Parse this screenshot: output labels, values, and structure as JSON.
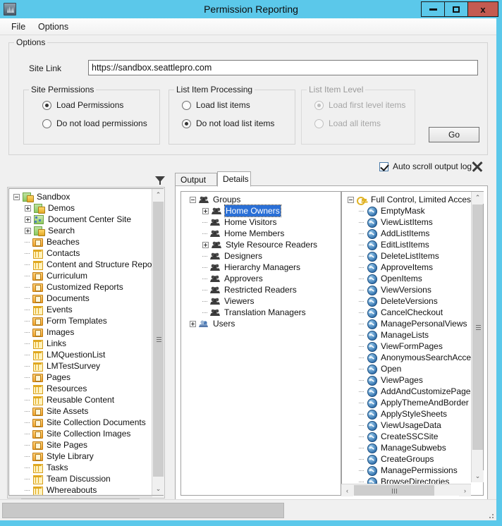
{
  "window": {
    "title": "Permission Reporting",
    "app_icon": "app-icon",
    "minimize_label": "",
    "maximize_label": "",
    "close_label": "x",
    "frame_color": "#5bc8ea"
  },
  "menu": {
    "items": [
      {
        "label": "File"
      },
      {
        "label": "Options"
      }
    ]
  },
  "options": {
    "legend": "Options",
    "site_link_label": "Site Link",
    "site_link_value": "https://sandbox.seattlepro.com",
    "site_link_placeholder": "",
    "site_permissions": {
      "legend": "Site Permissions",
      "options": [
        {
          "label": "Load Permissions",
          "checked": true
        },
        {
          "label": "Do not load permissions",
          "checked": false
        }
      ]
    },
    "list_item_processing": {
      "legend": "List Item Processing",
      "options": [
        {
          "label": "Load list items",
          "checked": false
        },
        {
          "label": "Do not load list items",
          "checked": true
        }
      ]
    },
    "list_item_level": {
      "legend": "List Item Level",
      "disabled": true,
      "options": [
        {
          "label": "Load first level items",
          "checked": true
        },
        {
          "label": "Load all items",
          "checked": false
        }
      ]
    },
    "go_button": "Go"
  },
  "toolbar": {
    "filter_icon": "funnel-icon",
    "auto_scroll_label": "Auto scroll output log",
    "auto_scroll_checked": true,
    "close_icon": "close-x-icon"
  },
  "tabs": [
    {
      "label": "Output Log",
      "active": false
    },
    {
      "label": "Details",
      "active": true
    }
  ],
  "site_tree": {
    "nodes": [
      {
        "label": "Sandbox",
        "indent": 0,
        "expander": "minus",
        "icon": "site-lock-icon"
      },
      {
        "label": "Demos",
        "indent": 1,
        "expander": "plus",
        "icon": "site-lock-icon"
      },
      {
        "label": "Document Center Site",
        "indent": 1,
        "expander": "plus",
        "icon": "site-icon"
      },
      {
        "label": "Search",
        "indent": 1,
        "expander": "plus",
        "icon": "site-lock-icon"
      },
      {
        "label": "Beaches",
        "indent": 1,
        "expander": "none",
        "icon": "library-icon"
      },
      {
        "label": "Contacts",
        "indent": 1,
        "expander": "none",
        "icon": "list-icon"
      },
      {
        "label": "Content and Structure Reports",
        "indent": 1,
        "expander": "none",
        "icon": "list-icon"
      },
      {
        "label": "Curriculum",
        "indent": 1,
        "expander": "none",
        "icon": "library-icon"
      },
      {
        "label": "Customized Reports",
        "indent": 1,
        "expander": "none",
        "icon": "library-icon"
      },
      {
        "label": "Documents",
        "indent": 1,
        "expander": "none",
        "icon": "library-icon"
      },
      {
        "label": "Events",
        "indent": 1,
        "expander": "none",
        "icon": "list-icon"
      },
      {
        "label": "Form Templates",
        "indent": 1,
        "expander": "none",
        "icon": "library-icon"
      },
      {
        "label": "Images",
        "indent": 1,
        "expander": "none",
        "icon": "library-icon"
      },
      {
        "label": "Links",
        "indent": 1,
        "expander": "none",
        "icon": "list-icon"
      },
      {
        "label": "LMQuestionList",
        "indent": 1,
        "expander": "none",
        "icon": "list-icon"
      },
      {
        "label": "LMTestSurvey",
        "indent": 1,
        "expander": "none",
        "icon": "list-icon"
      },
      {
        "label": "Pages",
        "indent": 1,
        "expander": "none",
        "icon": "library-icon"
      },
      {
        "label": "Resources",
        "indent": 1,
        "expander": "none",
        "icon": "list-icon"
      },
      {
        "label": "Reusable Content",
        "indent": 1,
        "expander": "none",
        "icon": "list-icon"
      },
      {
        "label": "Site Assets",
        "indent": 1,
        "expander": "none",
        "icon": "library-icon"
      },
      {
        "label": "Site Collection Documents",
        "indent": 1,
        "expander": "none",
        "icon": "library-icon"
      },
      {
        "label": "Site Collection Images",
        "indent": 1,
        "expander": "none",
        "icon": "library-lock-icon"
      },
      {
        "label": "Site Pages",
        "indent": 1,
        "expander": "none",
        "icon": "library-icon"
      },
      {
        "label": "Style Library",
        "indent": 1,
        "expander": "none",
        "icon": "library-lock-icon"
      },
      {
        "label": "Tasks",
        "indent": 1,
        "expander": "none",
        "icon": "list-icon"
      },
      {
        "label": "Team Discussion",
        "indent": 1,
        "expander": "none",
        "icon": "list-icon"
      },
      {
        "label": "Whereabouts",
        "indent": 1,
        "expander": "none",
        "icon": "list-icon"
      }
    ]
  },
  "groups_tree": {
    "nodes": [
      {
        "label": "Groups",
        "indent": 0,
        "expander": "minus",
        "icon": "group-icon",
        "selected": false
      },
      {
        "label": "Home Owners",
        "indent": 1,
        "expander": "plus",
        "icon": "group-icon",
        "selected": true
      },
      {
        "label": "Home Visitors",
        "indent": 1,
        "expander": "none",
        "icon": "group-icon",
        "selected": false
      },
      {
        "label": "Home Members",
        "indent": 1,
        "expander": "none",
        "icon": "group-icon",
        "selected": false
      },
      {
        "label": "Style Resource Readers",
        "indent": 1,
        "expander": "plus",
        "icon": "group-icon",
        "selected": false
      },
      {
        "label": "Designers",
        "indent": 1,
        "expander": "none",
        "icon": "group-icon",
        "selected": false
      },
      {
        "label": "Hierarchy Managers",
        "indent": 1,
        "expander": "none",
        "icon": "group-icon",
        "selected": false
      },
      {
        "label": "Approvers",
        "indent": 1,
        "expander": "none",
        "icon": "group-icon",
        "selected": false
      },
      {
        "label": "Restricted Readers",
        "indent": 1,
        "expander": "none",
        "icon": "group-icon",
        "selected": false
      },
      {
        "label": "Viewers",
        "indent": 1,
        "expander": "none",
        "icon": "group-icon",
        "selected": false
      },
      {
        "label": "Translation Managers",
        "indent": 1,
        "expander": "none",
        "icon": "group-icon",
        "selected": false
      },
      {
        "label": "Users",
        "indent": 0,
        "expander": "plus",
        "icon": "users-icon",
        "selected": false
      }
    ]
  },
  "permissions_tree": {
    "nodes": [
      {
        "label": "Full Control, Limited Access",
        "indent": 0,
        "expander": "minus",
        "icon": "key-icon"
      },
      {
        "label": "EmptyMask",
        "indent": 1,
        "expander": "none",
        "icon": "permission-icon"
      },
      {
        "label": "ViewListItems",
        "indent": 1,
        "expander": "none",
        "icon": "permission-icon"
      },
      {
        "label": "AddListItems",
        "indent": 1,
        "expander": "none",
        "icon": "permission-icon"
      },
      {
        "label": "EditListItems",
        "indent": 1,
        "expander": "none",
        "icon": "permission-icon"
      },
      {
        "label": "DeleteListItems",
        "indent": 1,
        "expander": "none",
        "icon": "permission-icon"
      },
      {
        "label": "ApproveItems",
        "indent": 1,
        "expander": "none",
        "icon": "permission-icon"
      },
      {
        "label": "OpenItems",
        "indent": 1,
        "expander": "none",
        "icon": "permission-icon"
      },
      {
        "label": "ViewVersions",
        "indent": 1,
        "expander": "none",
        "icon": "permission-icon"
      },
      {
        "label": "DeleteVersions",
        "indent": 1,
        "expander": "none",
        "icon": "permission-icon"
      },
      {
        "label": "CancelCheckout",
        "indent": 1,
        "expander": "none",
        "icon": "permission-icon"
      },
      {
        "label": "ManagePersonalViews",
        "indent": 1,
        "expander": "none",
        "icon": "permission-icon"
      },
      {
        "label": "ManageLists",
        "indent": 1,
        "expander": "none",
        "icon": "permission-icon"
      },
      {
        "label": "ViewFormPages",
        "indent": 1,
        "expander": "none",
        "icon": "permission-icon"
      },
      {
        "label": "AnonymousSearchAccess",
        "indent": 1,
        "expander": "none",
        "icon": "permission-icon"
      },
      {
        "label": "Open",
        "indent": 1,
        "expander": "none",
        "icon": "permission-icon"
      },
      {
        "label": "ViewPages",
        "indent": 1,
        "expander": "none",
        "icon": "permission-icon"
      },
      {
        "label": "AddAndCustomizePages",
        "indent": 1,
        "expander": "none",
        "icon": "permission-icon"
      },
      {
        "label": "ApplyThemeAndBorder",
        "indent": 1,
        "expander": "none",
        "icon": "permission-icon"
      },
      {
        "label": "ApplyStyleSheets",
        "indent": 1,
        "expander": "none",
        "icon": "permission-icon"
      },
      {
        "label": "ViewUsageData",
        "indent": 1,
        "expander": "none",
        "icon": "permission-icon"
      },
      {
        "label": "CreateSSCSite",
        "indent": 1,
        "expander": "none",
        "icon": "permission-icon"
      },
      {
        "label": "ManageSubwebs",
        "indent": 1,
        "expander": "none",
        "icon": "permission-icon"
      },
      {
        "label": "CreateGroups",
        "indent": 1,
        "expander": "none",
        "icon": "permission-icon"
      },
      {
        "label": "ManagePermissions",
        "indent": 1,
        "expander": "none",
        "icon": "permission-icon"
      },
      {
        "label": "BrowseDirectories",
        "indent": 1,
        "expander": "none",
        "icon": "permission-icon"
      }
    ]
  },
  "scrollbars": {
    "up_arrow": "⌃",
    "down_arrow": "⌄",
    "left_arrow": "‹",
    "right_arrow": "›"
  },
  "statusbar": {
    "progress_value": ""
  }
}
